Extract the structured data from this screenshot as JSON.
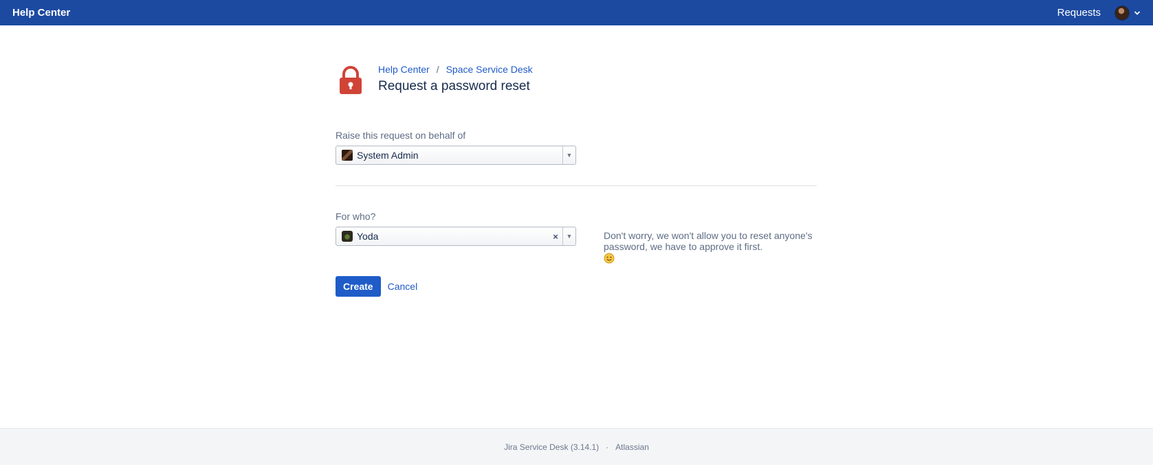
{
  "topbar": {
    "brand": "Help Center",
    "requests_label": "Requests",
    "color": "#1c4aa1"
  },
  "breadcrumb": {
    "items": [
      "Help Center",
      "Space Service Desk"
    ],
    "separator": "/"
  },
  "page": {
    "title": "Request a password reset",
    "icon": "lock-icon",
    "icon_color": "#d04437"
  },
  "form": {
    "behalf": {
      "label": "Raise this request on behalf of",
      "value": "System Admin"
    },
    "for_who": {
      "label": "For who?",
      "value": "Yoda",
      "clear_symbol": "×",
      "help_text": "Don't worry, we won't allow you to reset anyone's password, we have to approve it first."
    },
    "create_label": "Create",
    "cancel_label": "Cancel",
    "primary_color": "#1f5cc8"
  },
  "footer": {
    "product": "Jira Service Desk (3.14.1)",
    "separator": "·",
    "vendor": "Atlassian"
  }
}
